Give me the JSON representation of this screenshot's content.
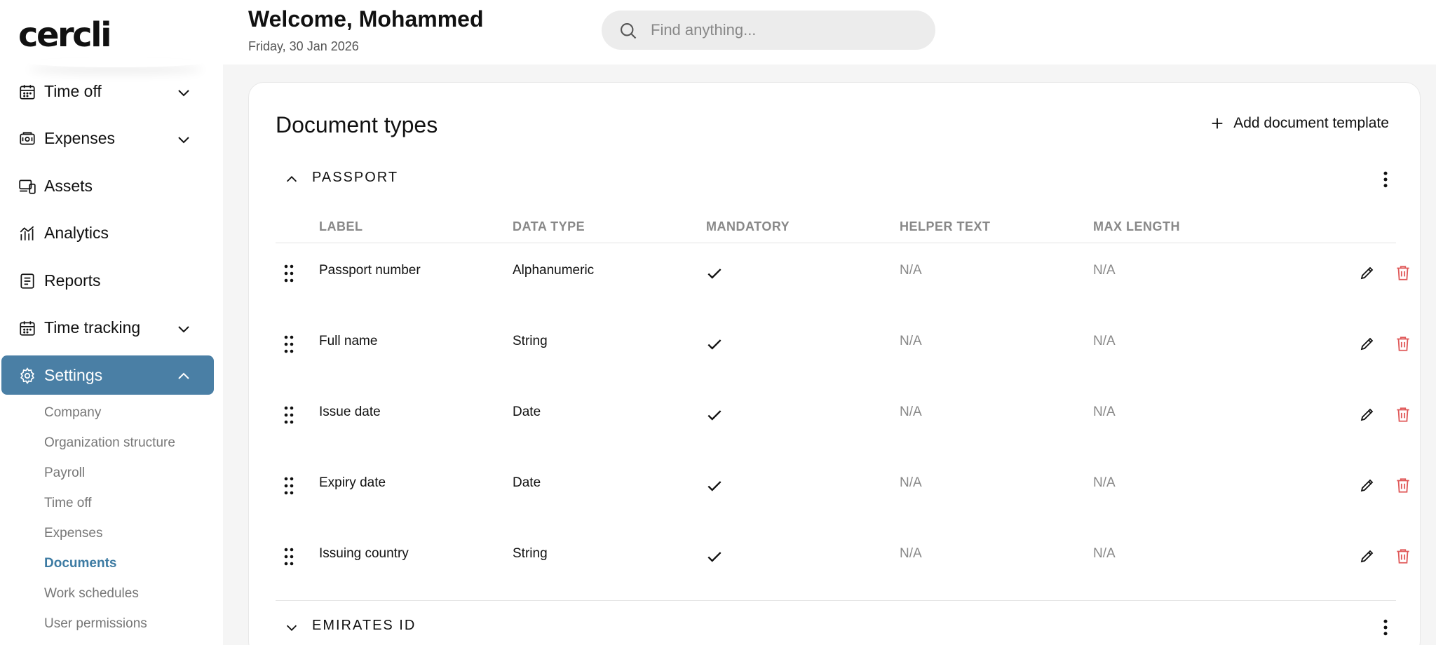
{
  "app": {
    "logo": "cercli"
  },
  "header": {
    "welcome": "Welcome, Mohammed",
    "date": "Friday, 30 Jan 2026",
    "search_placeholder": "Find anything..."
  },
  "sidebar": {
    "items": [
      {
        "label": "Time off",
        "icon": "calendar-icon",
        "expandable": true
      },
      {
        "label": "Expenses",
        "icon": "wallet-icon",
        "expandable": true
      },
      {
        "label": "Assets",
        "icon": "devices-icon",
        "expandable": false
      },
      {
        "label": "Analytics",
        "icon": "analytics-icon",
        "expandable": false
      },
      {
        "label": "Reports",
        "icon": "report-icon",
        "expandable": false
      },
      {
        "label": "Time tracking",
        "icon": "calendar-icon",
        "expandable": true
      },
      {
        "label": "Settings",
        "icon": "gear-icon",
        "expandable": true,
        "active": true
      }
    ],
    "settings_sub": [
      {
        "label": "Company"
      },
      {
        "label": "Organization structure"
      },
      {
        "label": "Payroll"
      },
      {
        "label": "Time off"
      },
      {
        "label": "Expenses"
      },
      {
        "label": "Documents",
        "active": true
      },
      {
        "label": "Work schedules"
      },
      {
        "label": "User permissions"
      }
    ]
  },
  "main": {
    "title": "Document types",
    "add_button": "Add document template",
    "sections": [
      {
        "title": "PASSPORT",
        "expanded": true
      },
      {
        "title": "EMIRATES ID",
        "expanded": false
      }
    ],
    "columns": [
      "LABEL",
      "DATA TYPE",
      "MANDATORY",
      "HELPER TEXT",
      "MAX LENGTH"
    ],
    "rows": [
      {
        "label": "Passport number",
        "data_type": "Alphanumeric",
        "mandatory": true,
        "helper_text": "N/A",
        "max_length": "N/A"
      },
      {
        "label": "Full name",
        "data_type": "String",
        "mandatory": true,
        "helper_text": "N/A",
        "max_length": "N/A"
      },
      {
        "label": "Issue date",
        "data_type": "Date",
        "mandatory": true,
        "helper_text": "N/A",
        "max_length": "N/A"
      },
      {
        "label": "Expiry date",
        "data_type": "Date",
        "mandatory": true,
        "helper_text": "N/A",
        "max_length": "N/A"
      },
      {
        "label": "Issuing country",
        "data_type": "String",
        "mandatory": true,
        "helper_text": "N/A",
        "max_length": "N/A"
      }
    ]
  },
  "colors": {
    "accent": "#4a7fa5",
    "active_link": "#3d7ba3",
    "delete": "#e05a5a"
  }
}
